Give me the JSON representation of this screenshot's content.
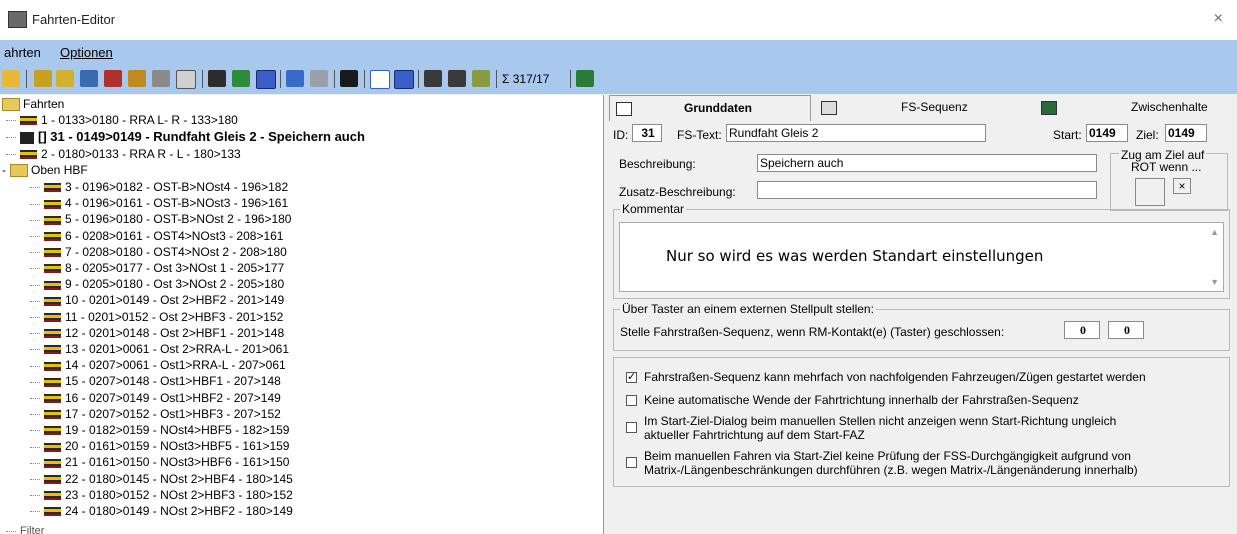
{
  "window": {
    "title": "Fahrten-Editor",
    "close_glyph": "×"
  },
  "menu": {
    "items": [
      "ahrten",
      "Optionen"
    ]
  },
  "toolbar": {
    "counter": "Σ 317/17"
  },
  "tree": {
    "root": "Fahrten",
    "items": [
      "1 - 0133>0180 - RRA L- R - 133>180",
      "[] 31 - 0149>0149 - Rundfaht Gleis 2 - Speichern auch",
      "2 - 0180>0133 - RRA R - L - 180>133"
    ],
    "folder": "Oben HBF",
    "children": [
      "3 - 0196>0182 - OST-B>NOst4 - 196>182",
      "4 - 0196>0161 - OST-B>NOst3 - 196>161",
      "5 - 0196>0180 - OST-B>NOst 2 - 196>180",
      "6 - 0208>0161 - OST4>NOst3 - 208>161",
      "7 - 0208>0180 - OST4>NOst 2 - 208>180",
      "8 - 0205>0177 - Ost 3>NOst 1 - 205>177",
      "9 - 0205>0180 - Ost 3>NOst 2 - 205>180",
      "10 - 0201>0149 - Ost 2>HBF2 - 201>149",
      "11 - 0201>0152 - Ost 2>HBF3 - 201>152",
      "12 - 0201>0148 - Ost 2>HBF1 - 201>148",
      "13 - 0201>0061 - Ost 2>RRA-L - 201>061",
      "14 - 0207>0061 - Ost1>RRA-L - 207>061",
      "15 - 0207>0148 - Ost1>HBF1 - 207>148",
      "16 - 0207>0149 - Ost1>HBF2 - 207>149",
      "17 - 0207>0152 - Ost1>HBF3 - 207>152",
      "19 - 0182>0159 - NOst4>HBF5 - 182>159",
      "20 - 0161>0159 - NOst3>HBF5 - 161>159",
      "21 - 0161>0150 - NOst3>HBF6 - 161>150",
      "22 - 0180>0145 - NOst 2>HBF4 - 180>145",
      "23 - 0180>0152 - NOst 2>HBF3 - 180>152",
      "24 - 0180>0149 - NOst 2>HBF2 - 180>149"
    ],
    "footer": "Filter"
  },
  "tabs": [
    "Grunddaten",
    "FS-Sequenz",
    "Zwischenhalte"
  ],
  "form": {
    "id_label": "ID:",
    "id_value": "31",
    "fstext_label": "FS-Text:",
    "fstext_value": "Rundfaht Gleis 2",
    "start_label": "Start:",
    "start_value": "0149",
    "ziel_label": "Ziel:",
    "ziel_value": "0149",
    "beschreibung_label": "Beschreibung:",
    "beschreibung_value": "Speichern auch",
    "zusatz_label": "Zusatz-Beschreibung:",
    "zusatz_value": "",
    "zug_rot_label_1": "Zug am Ziel auf",
    "zug_rot_label_2": "ROT wenn ...",
    "zug_rot_btn": "×",
    "kommentar_label": "Kommentar",
    "kommentar_value": "Nur so wird es was werden Standart einstellungen",
    "taster_group": "Über Taster an einem externen Stellpult stellen:",
    "taster_label": "Stelle Fahrstraßen-Sequenz, wenn RM-Kontakt(e) (Taster) geschlossen:",
    "taster_value_1": "0",
    "taster_value_2": "0"
  },
  "options": [
    {
      "label": "Fahrstraßen-Sequenz kann mehrfach von nachfolgenden Fahrzeugen/Zügen gestartet werden",
      "checked": true
    },
    {
      "label": "Keine automatische Wende der Fahrtrichtung innerhalb der Fahrstraßen-Sequenz",
      "checked": false
    },
    {
      "label": "Im Start-Ziel-Dialog beim manuellen Stellen nicht anzeigen wenn Start-Richtung ungleich\naktueller Fahrtrichtung auf dem Start-FAZ",
      "checked": false
    },
    {
      "label": "Beim manuellen Fahren via Start-Ziel keine Prüfung der FSS-Durchgängigkeit aufgrund von\nMatrix-/Längenbeschränkungen durchführen (z.B. wegen Matrix-/Längenänderung innerhalb)",
      "checked": false
    }
  ]
}
